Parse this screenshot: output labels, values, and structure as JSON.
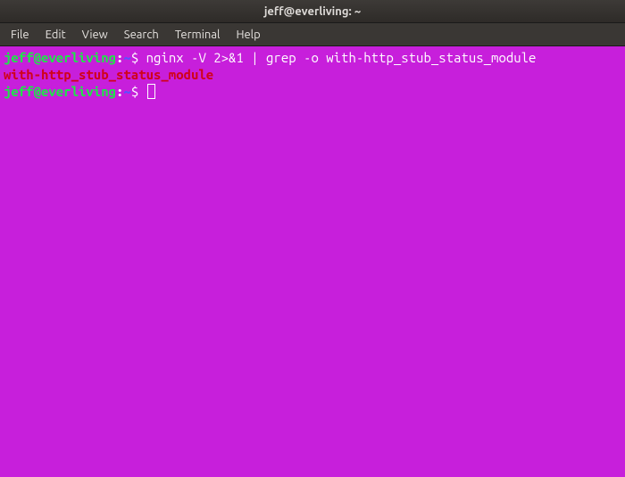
{
  "titlebar": {
    "title": "jeff@everliving: ~"
  },
  "menubar": {
    "items": [
      "File",
      "Edit",
      "View",
      "Search",
      "Terminal",
      "Help"
    ]
  },
  "terminal": {
    "lines": [
      {
        "prompt_user": "jeff@everliving",
        "prompt_colon": ":",
        "prompt_path": "~",
        "prompt_dollar": "$ ",
        "command": "nginx -V 2>&1 | grep -o with-http_stub_status_module"
      },
      {
        "output": "with-http_stub_status_module"
      },
      {
        "prompt_user": "jeff@everliving",
        "prompt_colon": ":",
        "prompt_path": "~",
        "prompt_dollar": "$ "
      }
    ]
  }
}
